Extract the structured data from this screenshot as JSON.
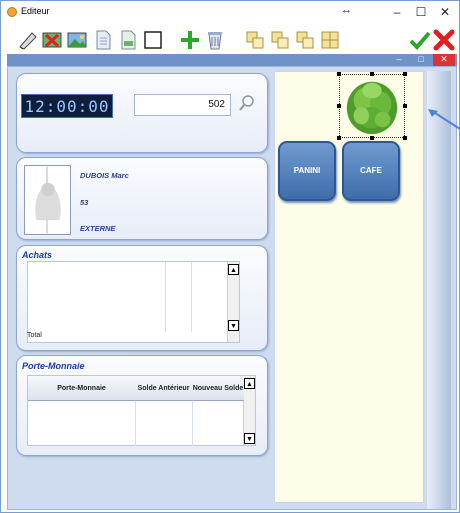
{
  "window": {
    "title": "Editeur",
    "resize_glyph": "↔",
    "minimize": "–",
    "maximize": "☐",
    "close": "✕"
  },
  "toolbar": {
    "tools": [
      {
        "name": "edit-tool-icon"
      },
      {
        "name": "delete-image-icon"
      },
      {
        "name": "image-icon"
      },
      {
        "name": "document-icon"
      },
      {
        "name": "document-alt-icon"
      },
      {
        "name": "frame-icon"
      },
      {
        "name": "add-icon"
      },
      {
        "name": "recycle-bin-icon"
      },
      {
        "name": "align-icon"
      },
      {
        "name": "align-right-icon"
      },
      {
        "name": "align-bottom-icon"
      },
      {
        "name": "group-icon"
      },
      {
        "name": "validate-icon"
      },
      {
        "name": "cancel-icon"
      }
    ],
    "accent_colors": {
      "green": "#29a829",
      "red": "#e02020",
      "yellow": "#e8d06a"
    }
  },
  "mdi": {
    "minimize": "–",
    "maximize": "□",
    "close": "✕"
  },
  "header_panel": {
    "clock": "12:00:00",
    "id_value": "502"
  },
  "customer": {
    "name": "DUBOIS Marc",
    "code": "53",
    "type": "EXTERNE"
  },
  "achats": {
    "title": "Achats",
    "total_label": "Total"
  },
  "wallet": {
    "title": "Porte-Monnaie",
    "columns": [
      "Porte-Monnaie",
      "Solde Antérieur",
      "Nouveau Solde"
    ]
  },
  "products": [
    {
      "label": "PANINI"
    },
    {
      "label": "CAFE"
    }
  ],
  "colors": {
    "window_border": "#7a9ccc",
    "mdi_strip": "#6f92c8",
    "button_blue": "#4a78b8",
    "catalog_bg": "#fdfde8"
  }
}
